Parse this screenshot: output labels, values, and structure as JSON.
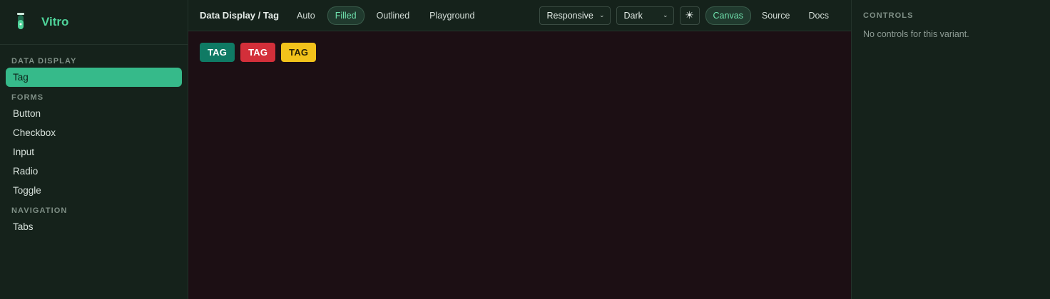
{
  "app": {
    "name": "Vitro"
  },
  "sidebar": {
    "groups": [
      {
        "label": "DATA DISPLAY",
        "items": [
          {
            "label": "Tag",
            "active": true
          }
        ]
      },
      {
        "label": "FORMS",
        "items": [
          {
            "label": "Button"
          },
          {
            "label": "Checkbox"
          },
          {
            "label": "Input"
          },
          {
            "label": "Radio"
          },
          {
            "label": "Toggle"
          }
        ]
      },
      {
        "label": "NAVIGATION",
        "items": [
          {
            "label": "Tabs"
          }
        ]
      }
    ]
  },
  "toolbar": {
    "breadcrumb": "Data Display / Tag",
    "variants": [
      "Auto",
      "Filled",
      "Outlined",
      "Playground"
    ],
    "active_variant": "Filled",
    "viewport_select": "Responsive",
    "theme_select": "Dark",
    "theme_toggle_icon": "sun-icon",
    "views": [
      "Canvas",
      "Source",
      "Docs"
    ],
    "active_view": "Canvas"
  },
  "canvas": {
    "tags": [
      {
        "label": "TAG",
        "bg": "#0f7a64",
        "fg": "#ffffff"
      },
      {
        "label": "TAG",
        "bg": "#d32f3a",
        "fg": "#ffffff"
      },
      {
        "label": "TAG",
        "bg": "#f2c21b",
        "fg": "#2a2205"
      }
    ]
  },
  "controls": {
    "title": "CONTROLS",
    "message": "No controls for this variant."
  },
  "colors": {
    "accent": "#36ba8a",
    "canvas_bg": "#1c0f14"
  }
}
